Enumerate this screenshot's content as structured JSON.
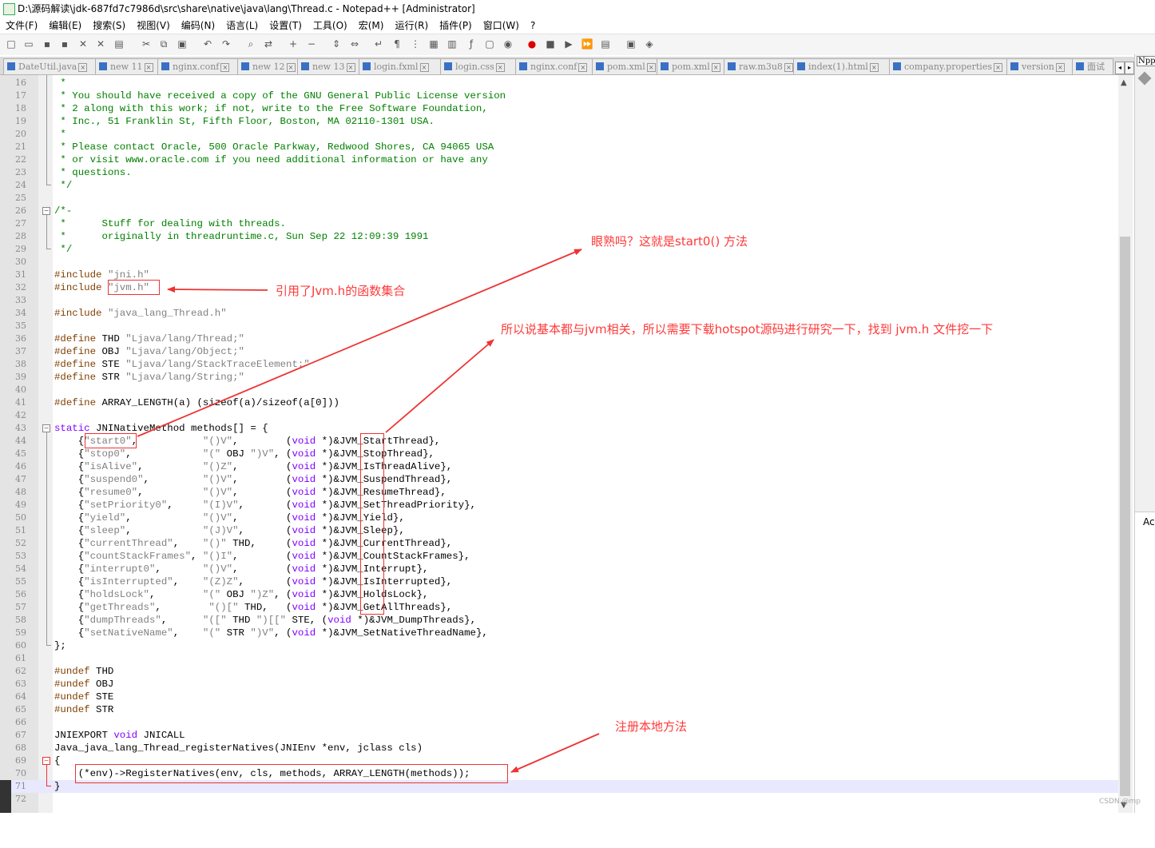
{
  "window": {
    "title": "D:\\源码解读\\jdk-687fd7c7986d\\src\\share\\native\\java\\lang\\Thread.c - Notepad++ [Administrator]"
  },
  "menu": [
    "文件(F)",
    "编辑(E)",
    "搜索(S)",
    "视图(V)",
    "编码(N)",
    "语言(L)",
    "设置(T)",
    "工具(O)",
    "宏(M)",
    "运行(R)",
    "插件(P)",
    "窗口(W)",
    "?"
  ],
  "tabs": [
    "DateUtil.java",
    "new 11",
    "nginx.conf",
    "new 12",
    "new 13",
    "login.fxml",
    "login.css",
    "nginx.conf",
    "pom.xml",
    "pom.xml",
    "raw.m3u8",
    "index(1).html",
    "company.properties",
    "version",
    "面试"
  ],
  "side_panel": {
    "top_label": "NppF",
    "bottom_label": "Ac"
  },
  "code_lines": [
    {
      "n": "16",
      "t": " *"
    },
    {
      "n": "17",
      "t": " * You should have received a copy of the GNU General Public License version"
    },
    {
      "n": "18",
      "t": " * 2 along with this work; if not, write to the Free Software Foundation,"
    },
    {
      "n": "19",
      "t": " * Inc., 51 Franklin St, Fifth Floor, Boston, MA 02110-1301 USA."
    },
    {
      "n": "20",
      "t": " *"
    },
    {
      "n": "21",
      "t": " * Please contact Oracle, 500 Oracle Parkway, Redwood Shores, CA 94065 USA"
    },
    {
      "n": "22",
      "t": " * or visit www.oracle.com if you need additional information or have any"
    },
    {
      "n": "23",
      "t": " * questions."
    },
    {
      "n": "24",
      "t": " */"
    },
    {
      "n": "25",
      "t": ""
    },
    {
      "n": "26",
      "t": "/*-"
    },
    {
      "n": "27",
      "t": " *      Stuff for dealing with threads."
    },
    {
      "n": "28",
      "t": " *      originally in threadruntime.c, Sun Sep 22 12:09:39 1991"
    },
    {
      "n": "29",
      "t": " */"
    },
    {
      "n": "30",
      "t": ""
    },
    {
      "n": "31",
      "t": "#include \"jni.h\""
    },
    {
      "n": "32",
      "t": "#include \"jvm.h\""
    },
    {
      "n": "33",
      "t": ""
    },
    {
      "n": "34",
      "t": "#include \"java_lang_Thread.h\""
    },
    {
      "n": "35",
      "t": ""
    },
    {
      "n": "36",
      "t": "#define THD \"Ljava/lang/Thread;\""
    },
    {
      "n": "37",
      "t": "#define OBJ \"Ljava/lang/Object;\""
    },
    {
      "n": "38",
      "t": "#define STE \"Ljava/lang/StackTraceElement;\""
    },
    {
      "n": "39",
      "t": "#define STR \"Ljava/lang/String;\""
    },
    {
      "n": "40",
      "t": ""
    },
    {
      "n": "41",
      "t": "#define ARRAY_LENGTH(a) (sizeof(a)/sizeof(a[0]))"
    },
    {
      "n": "42",
      "t": ""
    },
    {
      "n": "43",
      "t": "static JNINativeMethod methods[] = {"
    },
    {
      "n": "44",
      "t": "    {\"start0\",           \"()V\",        (void *)&JVM_StartThread},"
    },
    {
      "n": "45",
      "t": "    {\"stop0\",            \"(\" OBJ \")V\", (void *)&JVM_StopThread},"
    },
    {
      "n": "46",
      "t": "    {\"isAlive\",          \"()Z\",        (void *)&JVM_IsThreadAlive},"
    },
    {
      "n": "47",
      "t": "    {\"suspend0\",         \"()V\",        (void *)&JVM_SuspendThread},"
    },
    {
      "n": "48",
      "t": "    {\"resume0\",          \"()V\",        (void *)&JVM_ResumeThread},"
    },
    {
      "n": "49",
      "t": "    {\"setPriority0\",     \"(I)V\",       (void *)&JVM_SetThreadPriority},"
    },
    {
      "n": "50",
      "t": "    {\"yield\",            \"()V\",        (void *)&JVM_Yield},"
    },
    {
      "n": "51",
      "t": "    {\"sleep\",            \"(J)V\",       (void *)&JVM_Sleep},"
    },
    {
      "n": "52",
      "t": "    {\"currentThread\",    \"()\" THD,     (void *)&JVM_CurrentThread},"
    },
    {
      "n": "53",
      "t": "    {\"countStackFrames\", \"()I\",        (void *)&JVM_CountStackFrames},"
    },
    {
      "n": "54",
      "t": "    {\"interrupt0\",       \"()V\",        (void *)&JVM_Interrupt},"
    },
    {
      "n": "55",
      "t": "    {\"isInterrupted\",    \"(Z)Z\",       (void *)&JVM_IsInterrupted},"
    },
    {
      "n": "56",
      "t": "    {\"holdsLock\",        \"(\" OBJ \")Z\", (void *)&JVM_HoldsLock},"
    },
    {
      "n": "57",
      "t": "    {\"getThreads\",        \"()[\" THD,   (void *)&JVM_GetAllThreads},"
    },
    {
      "n": "58",
      "t": "    {\"dumpThreads\",      \"([\" THD \")[[\" STE, (void *)&JVM_DumpThreads},"
    },
    {
      "n": "59",
      "t": "    {\"setNativeName\",    \"(\" STR \")V\", (void *)&JVM_SetNativeThreadName},"
    },
    {
      "n": "60",
      "t": "};"
    },
    {
      "n": "61",
      "t": ""
    },
    {
      "n": "62",
      "t": "#undef THD"
    },
    {
      "n": "63",
      "t": "#undef OBJ"
    },
    {
      "n": "64",
      "t": "#undef STE"
    },
    {
      "n": "65",
      "t": "#undef STR"
    },
    {
      "n": "66",
      "t": ""
    },
    {
      "n": "67",
      "t": "JNIEXPORT void JNICALL"
    },
    {
      "n": "68",
      "t": "Java_java_lang_Thread_registerNatives(JNIEnv *env, jclass cls)"
    },
    {
      "n": "69",
      "t": "{"
    },
    {
      "n": "70",
      "t": "    (*env)->RegisterNatives(env, cls, methods, ARRAY_LENGTH(methods));"
    },
    {
      "n": "71",
      "t": "}"
    },
    {
      "n": "72",
      "t": ""
    }
  ],
  "annotations": {
    "start0": "眼熟吗？这就是start0() 方法",
    "jvm_h": "引用了Jvm.h的函数集合",
    "hotspot": "所以说基本都与jvm相关，所以需要下载hotspot源码进行研究一下，找到 jvm.h 文件挖一下",
    "register": "注册本地方法"
  },
  "colors": {
    "annotation": "#ff3a3a",
    "comment": "#008000",
    "preprocessor": "#804000",
    "string": "#808080",
    "keyword": "#8000ff"
  },
  "watermark": "CSDN @mp"
}
